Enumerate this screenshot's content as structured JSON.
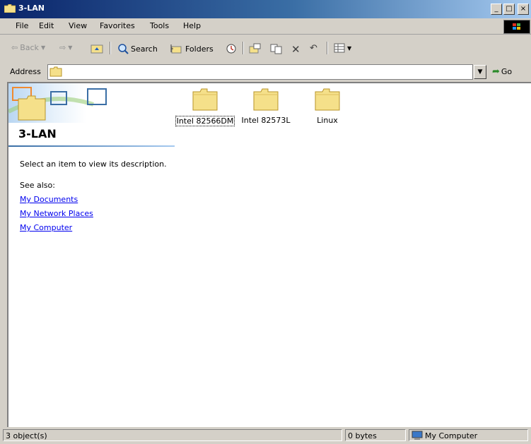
{
  "window": {
    "title": "3-LAN",
    "minimize": "_",
    "maximize": "□",
    "close": "×"
  },
  "menu": [
    "File",
    "Edit",
    "View",
    "Favorites",
    "Tools",
    "Help"
  ],
  "toolbar": {
    "back": "Back",
    "search": "Search",
    "folders": "Folders"
  },
  "address": {
    "label": "Address",
    "go": "Go"
  },
  "left_pane": {
    "folder_name": "3-LAN",
    "description": "Select an item to view its description.",
    "see_also": "See also:",
    "links": [
      "My Documents",
      "My Network Places",
      "My Computer"
    ]
  },
  "items": [
    {
      "label": "Intel 82566DM",
      "selected": true
    },
    {
      "label": "Intel 82573L",
      "selected": false
    },
    {
      "label": "Linux",
      "selected": false
    }
  ],
  "status": {
    "objects": "3 object(s)",
    "size": "0 bytes",
    "location": "My Computer"
  },
  "colors": {
    "titlebar": "#0a246a",
    "folder": "#f5e08a",
    "link": "#0000ee"
  }
}
